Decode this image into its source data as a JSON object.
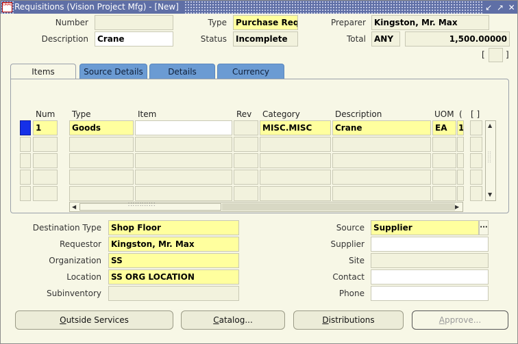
{
  "window": {
    "title": "Requisitions (Vision Project Mfg) - [New]",
    "icon_text": "ORACLE",
    "controls": {
      "minimize": "↙",
      "maximize": "↗",
      "close": "✕"
    }
  },
  "header": {
    "number": {
      "label": "Number",
      "value": ""
    },
    "type": {
      "label": "Type",
      "value": "Purchase Requ"
    },
    "preparer": {
      "label": "Preparer",
      "value": "Kingston, Mr. Max"
    },
    "description": {
      "label": "Description",
      "value": "Crane"
    },
    "status": {
      "label": "Status",
      "value": "Incomplete"
    },
    "total": {
      "label": "Total",
      "currency": "ANY",
      "value": "1,500.00000"
    },
    "flex_bracket_left": "[",
    "flex_bracket_right": "]"
  },
  "tabs": [
    "Items",
    "Source Details",
    "Details",
    "Currency"
  ],
  "grid": {
    "columns": [
      "Num",
      "Type",
      "Item",
      "Rev",
      "Category",
      "Description",
      "UOM",
      "(",
      "[ ]"
    ],
    "rows": [
      {
        "num": "1",
        "type": "Goods",
        "item": "",
        "rev": "",
        "category": "MISC.MISC",
        "description": "Crane",
        "uom": "EA",
        "qty": "1"
      }
    ]
  },
  "lower": {
    "destination_type": {
      "label": "Destination Type",
      "value": "Shop Floor"
    },
    "requestor": {
      "label": "Requestor",
      "value": "Kingston, Mr. Max"
    },
    "organization": {
      "label": "Organization",
      "value": "SS"
    },
    "location": {
      "label": "Location",
      "value": "SS ORG LOCATION"
    },
    "subinventory": {
      "label": "Subinventory",
      "value": ""
    },
    "source": {
      "label": "Source",
      "value": "Supplier",
      "lov": "···"
    },
    "supplier": {
      "label": "Supplier",
      "value": ""
    },
    "site": {
      "label": "Site",
      "value": ""
    },
    "contact": {
      "label": "Contact",
      "value": ""
    },
    "phone": {
      "label": "Phone",
      "value": ""
    }
  },
  "buttons": {
    "outside_services": {
      "ul": "O",
      "rest": "utside Services"
    },
    "catalog": {
      "ul": "C",
      "rest": "atalog..."
    },
    "distributions": {
      "ul": "D",
      "rest": "istributions"
    },
    "approve": {
      "ul": "A",
      "rest": "pprove..."
    }
  },
  "colors": {
    "required": "#ffff9e",
    "background": "#f7f7e6",
    "tab": "#6b9bd3",
    "titlebar": "#5f6fa6",
    "current_record": "#1530e8"
  }
}
